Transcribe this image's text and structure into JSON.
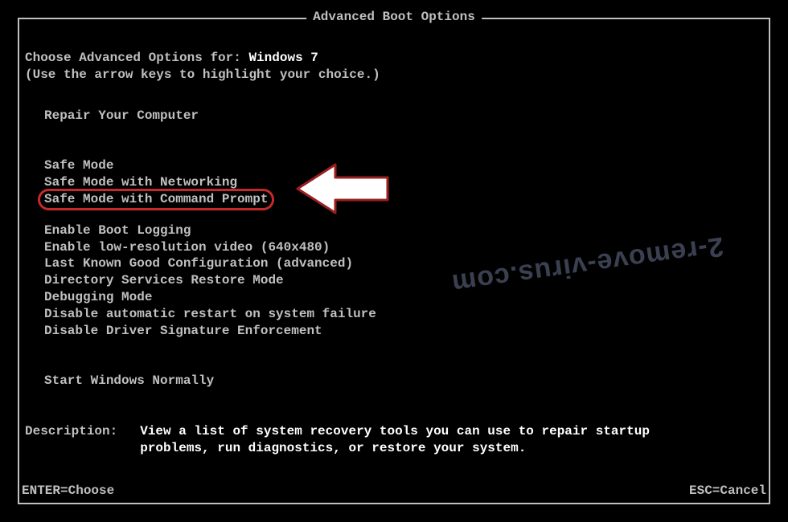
{
  "title": "Advanced Boot Options",
  "choose_prefix": "Choose Advanced Options for: ",
  "os_name": "Windows 7",
  "hint": "(Use the arrow keys to highlight your choice.)",
  "group_top": {
    "repair": "Repair Your Computer"
  },
  "group_safe": {
    "safe": "Safe Mode",
    "safe_net": "Safe Mode with Networking",
    "safe_cmd": "Safe Mode with Command Prompt"
  },
  "group_adv": {
    "boot_log": "Enable Boot Logging",
    "low_res": "Enable low-resolution video (640x480)",
    "lkg": "Last Known Good Configuration (advanced)",
    "dsrm": "Directory Services Restore Mode",
    "debug": "Debugging Mode",
    "no_auto_restart": "Disable automatic restart on system failure",
    "no_drv_sig": "Disable Driver Signature Enforcement"
  },
  "group_normal": {
    "start_normal": "Start Windows Normally"
  },
  "description": {
    "label": "Description:",
    "text": "View a list of system recovery tools you can use to repair startup problems, run diagnostics, or restore your system."
  },
  "footer": {
    "enter": "ENTER=Choose",
    "esc": "ESC=Cancel"
  },
  "watermark": "2-remove-virus.com",
  "highlighted_option": "safe_cmd"
}
